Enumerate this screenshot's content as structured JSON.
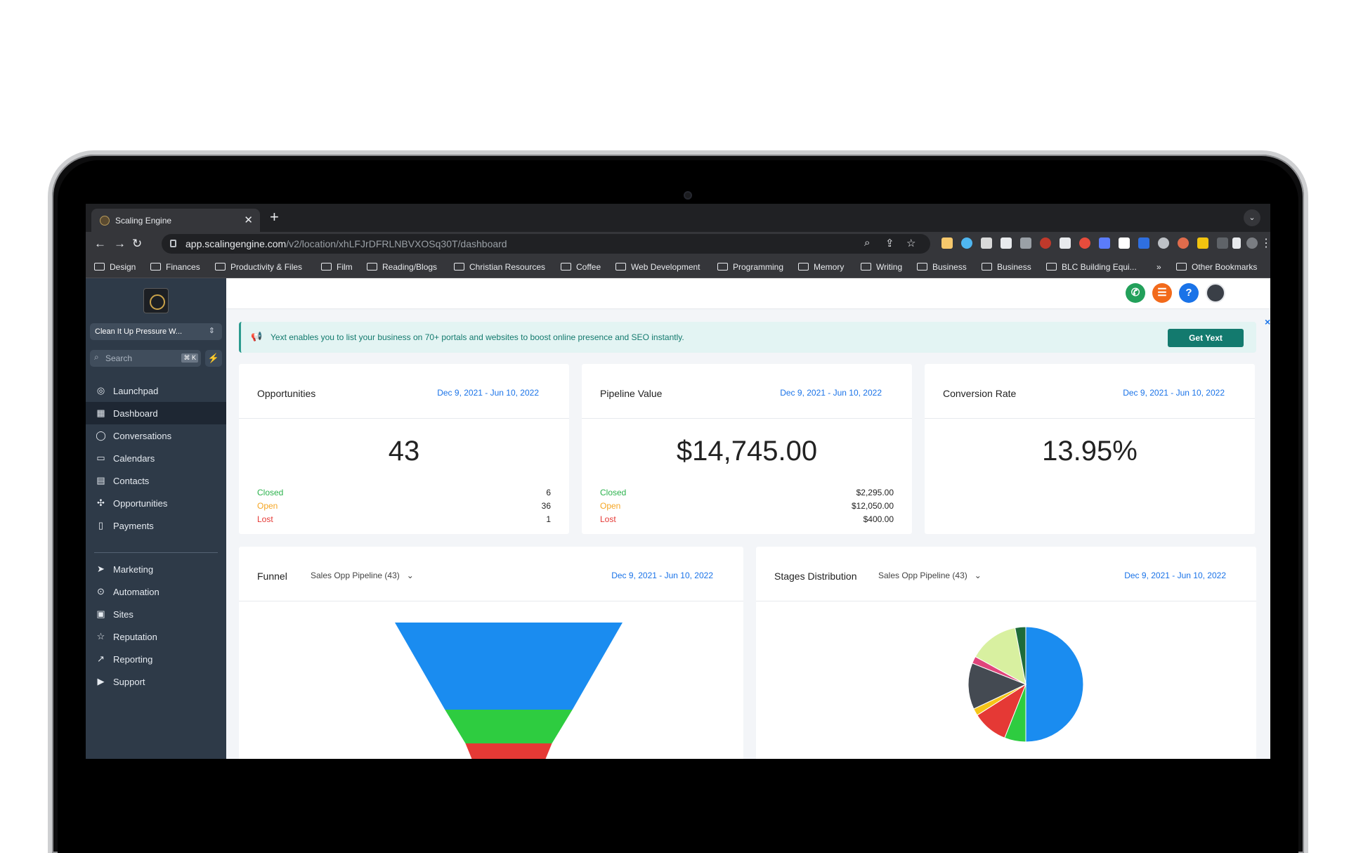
{
  "browser": {
    "tab_title": "Scaling Engine",
    "url_host": "app.scalingengine.com",
    "url_path": "/v2/location/xhLFJrDFRLNBVXOSq30T/dashboard",
    "bookmarks": [
      "Design",
      "Finances",
      "Productivity & Files",
      "Film",
      "Reading/Blogs",
      "Christian Resources",
      "Coffee",
      "Web Development",
      "Programming",
      "Memory",
      "Writing",
      "Business",
      "Business",
      "BLC Building Equi...",
      "»",
      "Other Bookmarks"
    ]
  },
  "sidebar": {
    "account": "Clean It Up Pressure W...",
    "search_placeholder": "Search",
    "search_shortcut": "⌘ K",
    "items": [
      {
        "label": "Launchpad",
        "icon": "rocket-icon"
      },
      {
        "label": "Dashboard",
        "icon": "grid-icon"
      },
      {
        "label": "Conversations",
        "icon": "chat-icon"
      },
      {
        "label": "Calendars",
        "icon": "calendar-icon"
      },
      {
        "label": "Contacts",
        "icon": "contacts-icon"
      },
      {
        "label": "Opportunities",
        "icon": "opportunities-icon"
      },
      {
        "label": "Payments",
        "icon": "receipt-icon"
      },
      {
        "label": "Marketing",
        "icon": "send-icon"
      },
      {
        "label": "Automation",
        "icon": "automation-icon"
      },
      {
        "label": "Sites",
        "icon": "sites-icon"
      },
      {
        "label": "Reputation",
        "icon": "star-icon"
      },
      {
        "label": "Reporting",
        "icon": "trend-icon"
      },
      {
        "label": "Support",
        "icon": "play-icon"
      }
    ]
  },
  "banner": {
    "text": "Yext enables you to list your business on 70+ portals and websites to boost online presence and SEO instantly.",
    "button": "Get Yext",
    "close": "×"
  },
  "cards": {
    "opportunities": {
      "title": "Opportunities",
      "date": "Dec 9, 2021 - Jun 10, 2022",
      "value": "43",
      "stats": [
        {
          "label": "Closed",
          "value": "6"
        },
        {
          "label": "Open",
          "value": "36"
        },
        {
          "label": "Lost",
          "value": "1"
        }
      ]
    },
    "pipeline": {
      "title": "Pipeline Value",
      "date": "Dec 9, 2021 - Jun 10, 2022",
      "value": "$14,745.00",
      "stats": [
        {
          "label": "Closed",
          "value": "$2,295.00"
        },
        {
          "label": "Open",
          "value": "$12,050.00"
        },
        {
          "label": "Lost",
          "value": "$400.00"
        }
      ]
    },
    "conversion": {
      "title": "Conversion Rate",
      "date": "Dec 9, 2021 - Jun 10, 2022",
      "value": "13.95%"
    },
    "funnel": {
      "title": "Funnel",
      "pipeline": "Sales Opp Pipeline (43)",
      "date": "Dec 9, 2021 - Jun 10, 2022"
    },
    "stages": {
      "title": "Stages Distribution",
      "pipeline": "Sales Opp Pipeline (43)",
      "date": "Dec 9, 2021 - Jun 10, 2022"
    }
  },
  "colors": {
    "closed": "#2bb24c",
    "open": "#f5a623",
    "lost": "#e53935",
    "accent": "#1a73e8"
  },
  "chart_data": [
    {
      "type": "funnel",
      "stages": [
        {
          "color": "#1a8cf0",
          "share": 1.0
        },
        {
          "color": "#2ecc40",
          "share": 0.56
        },
        {
          "color": "#e53935",
          "share": 0.38
        }
      ]
    },
    {
      "type": "pie",
      "slices": [
        {
          "value": 50,
          "color": "#1a8cf0"
        },
        {
          "value": 6,
          "color": "#2ecc40"
        },
        {
          "value": 10,
          "color": "#e53935"
        },
        {
          "value": 2,
          "color": "#f5c518"
        },
        {
          "value": 13,
          "color": "#444a52"
        },
        {
          "value": 2,
          "color": "#e0457b"
        },
        {
          "value": 14,
          "color": "#d8f0a0"
        },
        {
          "value": 3,
          "color": "#1e6b3a"
        }
      ]
    }
  ]
}
